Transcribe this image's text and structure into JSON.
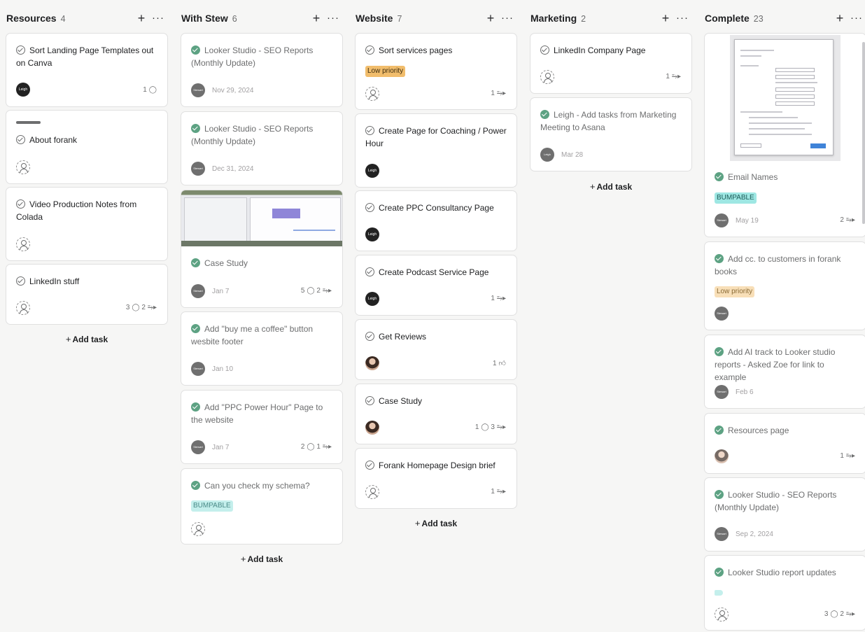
{
  "columns": [
    {
      "title": "Resources",
      "count": "4",
      "cards": [
        {
          "title": "Sort Landing Page Templates out on Canva",
          "comments": "1"
        },
        {
          "title": "About forank"
        },
        {
          "title": "Video Production Notes from Colada"
        },
        {
          "title": "LinkedIn stuff",
          "comments": "3",
          "subtasks": "2"
        }
      ],
      "add_task": "Add task"
    },
    {
      "title": "With Stew",
      "count": "6",
      "cards": [
        {
          "title": "Looker Studio - SEO Reports (Monthly Update)",
          "date": "Nov 29, 2024"
        },
        {
          "title": "Looker Studio - SEO Reports (Monthly Update)",
          "date": "Dec 31, 2024"
        },
        {
          "title": "Case Study",
          "date": "Jan 7",
          "comments": "5",
          "subtasks": "2"
        },
        {
          "title": "Add \"buy me a coffee\" button wesbite footer",
          "date": "Jan 10"
        },
        {
          "title": "Add \"PPC Power Hour\" Page to the website",
          "date": "Jan 7",
          "comments": "2",
          "subtasks": "1"
        },
        {
          "title": "Can you check my schema?",
          "tag": "BUMPABLE"
        }
      ],
      "add_task": "Add task"
    },
    {
      "title": "Website",
      "count": "7",
      "cards": [
        {
          "title": "Sort services pages",
          "tag": "Low priority",
          "subtasks": "1"
        },
        {
          "title": "Create Page for Coaching / Power Hour"
        },
        {
          "title": "Create PPC Consultancy Page"
        },
        {
          "title": "Create Podcast Service Page",
          "subtasks": "1"
        },
        {
          "title": "Get Reviews",
          "likes": "1"
        },
        {
          "title": "Case Study",
          "comments": "1",
          "subtasks": "3"
        },
        {
          "title": "Forank Homepage Design brief",
          "subtasks": "1"
        }
      ],
      "add_task": "Add task"
    },
    {
      "title": "Marketing",
      "count": "2",
      "cards": [
        {
          "title": "LinkedIn Company Page",
          "subtasks": "1"
        },
        {
          "title": "Leigh - Add tasks from Marketing Meeting to Asana",
          "date": "Mar 28"
        }
      ],
      "add_task": "Add task"
    },
    {
      "title": "Complete",
      "count": "23",
      "cards": [
        {
          "title": "Email Names",
          "tag": "BUMPABLE",
          "date": "May 19",
          "subtasks": "2"
        },
        {
          "title": "Add cc. to customers in forank books",
          "tag": "Low priority"
        },
        {
          "title": "Add AI track to Looker studio reports - Asked Zoe for link to example",
          "date": "Feb 6"
        },
        {
          "title": "Resources page",
          "subtasks": "1"
        },
        {
          "title": "Looker Studio - SEO Reports (Monthly Update)",
          "date": "Sep 2, 2024"
        },
        {
          "title": "Looker Studio report updates",
          "comments": "3",
          "subtasks": "2"
        }
      ]
    }
  ],
  "avatar_initials": {
    "leigh": "Leigh",
    "stewart": "Stewart"
  },
  "icons": {
    "add": "plus-icon",
    "more": "ellipsis-icon",
    "check": "check-circle-icon",
    "comment": "comment-icon",
    "subtask": "subtask-icon",
    "like": "thumbs-up-icon"
  },
  "colors": {
    "complete_check": "#5da283",
    "low_priority": "#f1bd6c",
    "bumpable": "#9ee7e3",
    "background": "#f6f6f5"
  }
}
